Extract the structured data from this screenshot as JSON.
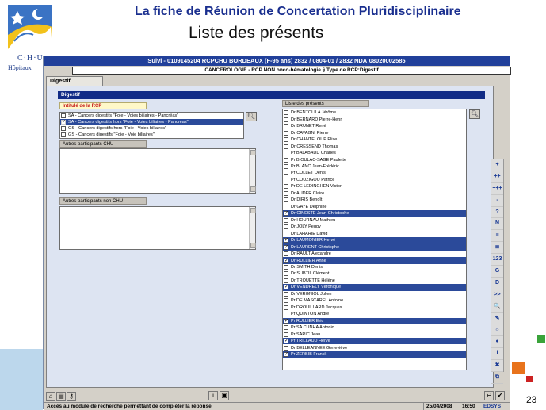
{
  "slide": {
    "title": "La fiche de Réunion de Concertation Pluridisciplinaire",
    "subtitle": "Liste des présents",
    "page_number": "23",
    "logo_text": "C·H·U",
    "logo_sub": "Hôpitaux",
    "colors": {
      "title": "#1a2f8f",
      "accent_orange": "#e8731c",
      "accent_green": "#3aa33a",
      "accent_red": "#cc2222"
    }
  },
  "app": {
    "header1": "Suivi - 0109145204 RCPCHU BORDEAUX (F-95 ans) 2832 / 0804-01 / 2832 NDA:08020002585",
    "header2": "CANCEROLOGIE - RCP NON onco-hématologie § Type de RCP:Digestif",
    "tab": "Digestif",
    "section": "Digestif",
    "rcp_label": "Intitulé de la RCP",
    "rcp_items": [
      {
        "label": "SA - Cancers digestifs \"Foie - Voies biliaires - Pancréas\"",
        "checked": false,
        "selected": false
      },
      {
        "label": "SA - Cancers digestifs hors \"Foie - Voies biliaires - Pancréas\"",
        "checked": true,
        "selected": true
      },
      {
        "label": "GS - Cancers digestifs hors \"Foie - Voies biliaires\"",
        "checked": false,
        "selected": false
      },
      {
        "label": "GS - Cancers digestifs \"Foie - Voie biliaires\"",
        "checked": false,
        "selected": false
      }
    ],
    "chu_label": "Autres participants CHU",
    "nonchu_label": "Autres participants non CHU",
    "presents_label": "Liste des présents",
    "presents": [
      {
        "name": "Dr BENTOLILA Jérôme",
        "checked": false,
        "selected": false
      },
      {
        "name": "Dr BERNARD Pierre-Henri",
        "checked": false,
        "selected": false
      },
      {
        "name": "Dr BRUNET René",
        "checked": false,
        "selected": false
      },
      {
        "name": "Dr CAVAGNI Pierre",
        "checked": false,
        "selected": false
      },
      {
        "name": "Dr CHANTELOUP Elise",
        "checked": false,
        "selected": false
      },
      {
        "name": "Dr CRESSEND Thomas",
        "checked": false,
        "selected": false
      },
      {
        "name": "Pr BALABAUD Charles",
        "checked": false,
        "selected": false
      },
      {
        "name": "Pr BIOULAC-SAGE Paulette",
        "checked": false,
        "selected": false
      },
      {
        "name": "Pr BLANC Jean-Frédéric",
        "checked": false,
        "selected": false
      },
      {
        "name": "Pr COLLET Denis",
        "checked": false,
        "selected": false
      },
      {
        "name": "Pr COUZIGOU Patrice",
        "checked": false,
        "selected": false
      },
      {
        "name": "Pr DE LEDINGHEN Victor",
        "checked": false,
        "selected": false
      },
      {
        "name": "Dr AUDER Claire",
        "checked": false,
        "selected": false
      },
      {
        "name": "Dr DIRIS Benoît",
        "checked": false,
        "selected": false
      },
      {
        "name": "Dr GAYE Delphine",
        "checked": false,
        "selected": false
      },
      {
        "name": "Dr GINESTE Jean-Christophe",
        "checked": true,
        "selected": true
      },
      {
        "name": "Dr HOURNAU Mathieu",
        "checked": false,
        "selected": false
      },
      {
        "name": "Dr JOLY Peggy",
        "checked": false,
        "selected": false
      },
      {
        "name": "Dr LAHARIE David",
        "checked": false,
        "selected": false
      },
      {
        "name": "Dr LAUMONIER Hervé",
        "checked": true,
        "selected": true
      },
      {
        "name": "Dr LAURENT Christophe",
        "checked": true,
        "selected": true
      },
      {
        "name": "Dr RAULT Alexandre",
        "checked": false,
        "selected": false
      },
      {
        "name": "Dr RULLIER Anne",
        "checked": true,
        "selected": true
      },
      {
        "name": "Dr SMITH Denis",
        "checked": false,
        "selected": false
      },
      {
        "name": "Dr SUBTIL Clément",
        "checked": false,
        "selected": false
      },
      {
        "name": "Dr TROUETTE Hélène",
        "checked": false,
        "selected": false
      },
      {
        "name": "Dr VENDRELY Véronique",
        "checked": true,
        "selected": true
      },
      {
        "name": "Dr VERGNIOL Julien",
        "checked": false,
        "selected": false
      },
      {
        "name": "Pr DE MASCAREL Antoine",
        "checked": false,
        "selected": false
      },
      {
        "name": "Pr DROUILLARD Jacques",
        "checked": false,
        "selected": false
      },
      {
        "name": "Pr QUINTON André",
        "checked": false,
        "selected": false
      },
      {
        "name": "Pr RULLIER Eric",
        "checked": true,
        "selected": true
      },
      {
        "name": "Pr SA CUNHA Antonio",
        "checked": false,
        "selected": false
      },
      {
        "name": "Pr SARIC Jean",
        "checked": false,
        "selected": false
      },
      {
        "name": "Pr TRILLAUD Hervé",
        "checked": true,
        "selected": true
      },
      {
        "name": "Dr BELLEANNEE Geneviève",
        "checked": false,
        "selected": false
      },
      {
        "name": "Pr ZERBIB Franck",
        "checked": true,
        "selected": true
      }
    ],
    "toolbar": [
      "+",
      "++",
      "+++",
      "-",
      "?",
      "N",
      "≡",
      "≣",
      "123",
      "G",
      "D",
      ">>",
      "🔍",
      "✎",
      "☼",
      "●",
      "i",
      "✖",
      "⧉"
    ],
    "status": {
      "text": "Accès au module de recherche permettant de compléter la réponse",
      "date": "25/04/2008",
      "time": "16:50",
      "brand": "EDSYS"
    }
  }
}
